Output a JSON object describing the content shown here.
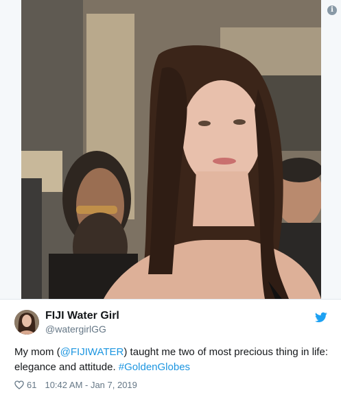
{
  "tweet": {
    "media": {
      "info_glyph": "i",
      "icons": {
        "info": "info-icon"
      }
    },
    "author": {
      "display_name": "FIJI Water Girl",
      "handle": "@watergirlGG"
    },
    "text": {
      "prefix": "My mom (",
      "mention": "@FIJIWATER",
      "middle": ") taught me two of most precious thing in life: elegance and attitude. ",
      "hashtag": "#GoldenGlobes"
    },
    "meta": {
      "likes": "61",
      "timestamp": "10:42 AM - Jan 7, 2019"
    },
    "icons": {
      "platform": "twitter-bird-icon",
      "like": "heart-icon"
    },
    "colors": {
      "link": "#1b95e0",
      "secondary_text": "#657786",
      "primary_text": "#14171a",
      "brand": "#1da1f2"
    }
  }
}
